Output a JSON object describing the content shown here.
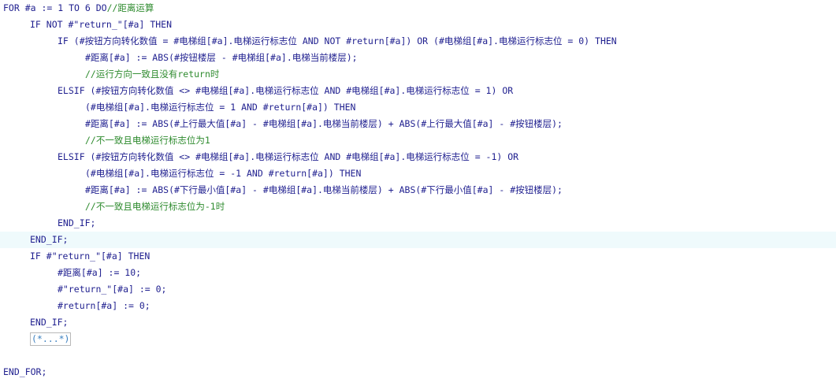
{
  "code": {
    "lines": [
      {
        "indent": 0,
        "text": "FOR #a := 1 TO 6 DO",
        "comment": "//距离运算"
      },
      {
        "indent": 1,
        "text": "IF NOT #\"return_\"[#a] THEN",
        "comment": ""
      },
      {
        "indent": 2,
        "text": "IF (#按钮方向转化数值 = #电梯组[#a].电梯运行标志位 AND NOT #return[#a]) OR (#电梯组[#a].电梯运行标志位 = 0) THEN",
        "comment": ""
      },
      {
        "indent": 3,
        "text": "#距离[#a] := ABS(#按钮楼层 - #电梯组[#a].电梯当前楼层);",
        "comment": ""
      },
      {
        "indent": 3,
        "text": "",
        "comment": "//运行方向一致且没有return时"
      },
      {
        "indent": 2,
        "text": "ELSIF (#按钮方向转化数值 <> #电梯组[#a].电梯运行标志位 AND #电梯组[#a].电梯运行标志位 = 1) OR",
        "comment": ""
      },
      {
        "indent": 3,
        "text": "(#电梯组[#a].电梯运行标志位 = 1 AND #return[#a]) THEN",
        "comment": ""
      },
      {
        "indent": 3,
        "text": "#距离[#a] := ABS(#上行最大值[#a] - #电梯组[#a].电梯当前楼层) + ABS(#上行最大值[#a] - #按钮楼层);",
        "comment": ""
      },
      {
        "indent": 3,
        "text": "",
        "comment": "//不一致且电梯运行标志位为1"
      },
      {
        "indent": 2,
        "text": "ELSIF (#按钮方向转化数值 <> #电梯组[#a].电梯运行标志位 AND #电梯组[#a].电梯运行标志位 = -1) OR",
        "comment": ""
      },
      {
        "indent": 3,
        "text": "(#电梯组[#a].电梯运行标志位 = -1 AND #return[#a]) THEN",
        "comment": ""
      },
      {
        "indent": 3,
        "text": "#距离[#a] := ABS(#下行最小值[#a] - #电梯组[#a].电梯当前楼层) + ABS(#下行最小值[#a] - #按钮楼层);",
        "comment": ""
      },
      {
        "indent": 3,
        "text": "",
        "comment": "//不一致且电梯运行标志位为-1时"
      },
      {
        "indent": 2,
        "text": "END_IF;",
        "comment": ""
      },
      {
        "indent": 1,
        "text": "END_IF;",
        "comment": ""
      },
      {
        "indent": 1,
        "text": "IF #\"return_\"[#a] THEN",
        "comment": ""
      },
      {
        "indent": 2,
        "text": "#距离[#a] := 10;",
        "comment": ""
      },
      {
        "indent": 2,
        "text": "#\"return_\"[#a] := 0;",
        "comment": ""
      },
      {
        "indent": 2,
        "text": "#return[#a] := 0;",
        "comment": ""
      },
      {
        "indent": 1,
        "text": "END_IF;",
        "comment": ""
      },
      {
        "indent": 1,
        "text": "",
        "comment": ""
      },
      {
        "indent": 0,
        "text": "",
        "comment": ""
      },
      {
        "indent": 0,
        "text": "END_FOR;",
        "comment": ""
      }
    ],
    "fold_marker": "(*...*)",
    "highlight_line": 14,
    "colors": {
      "keyword": "#1f1f8f",
      "comment": "#2e8b2e",
      "highlight": "#effafc",
      "fold": "#3a7fbf"
    }
  }
}
